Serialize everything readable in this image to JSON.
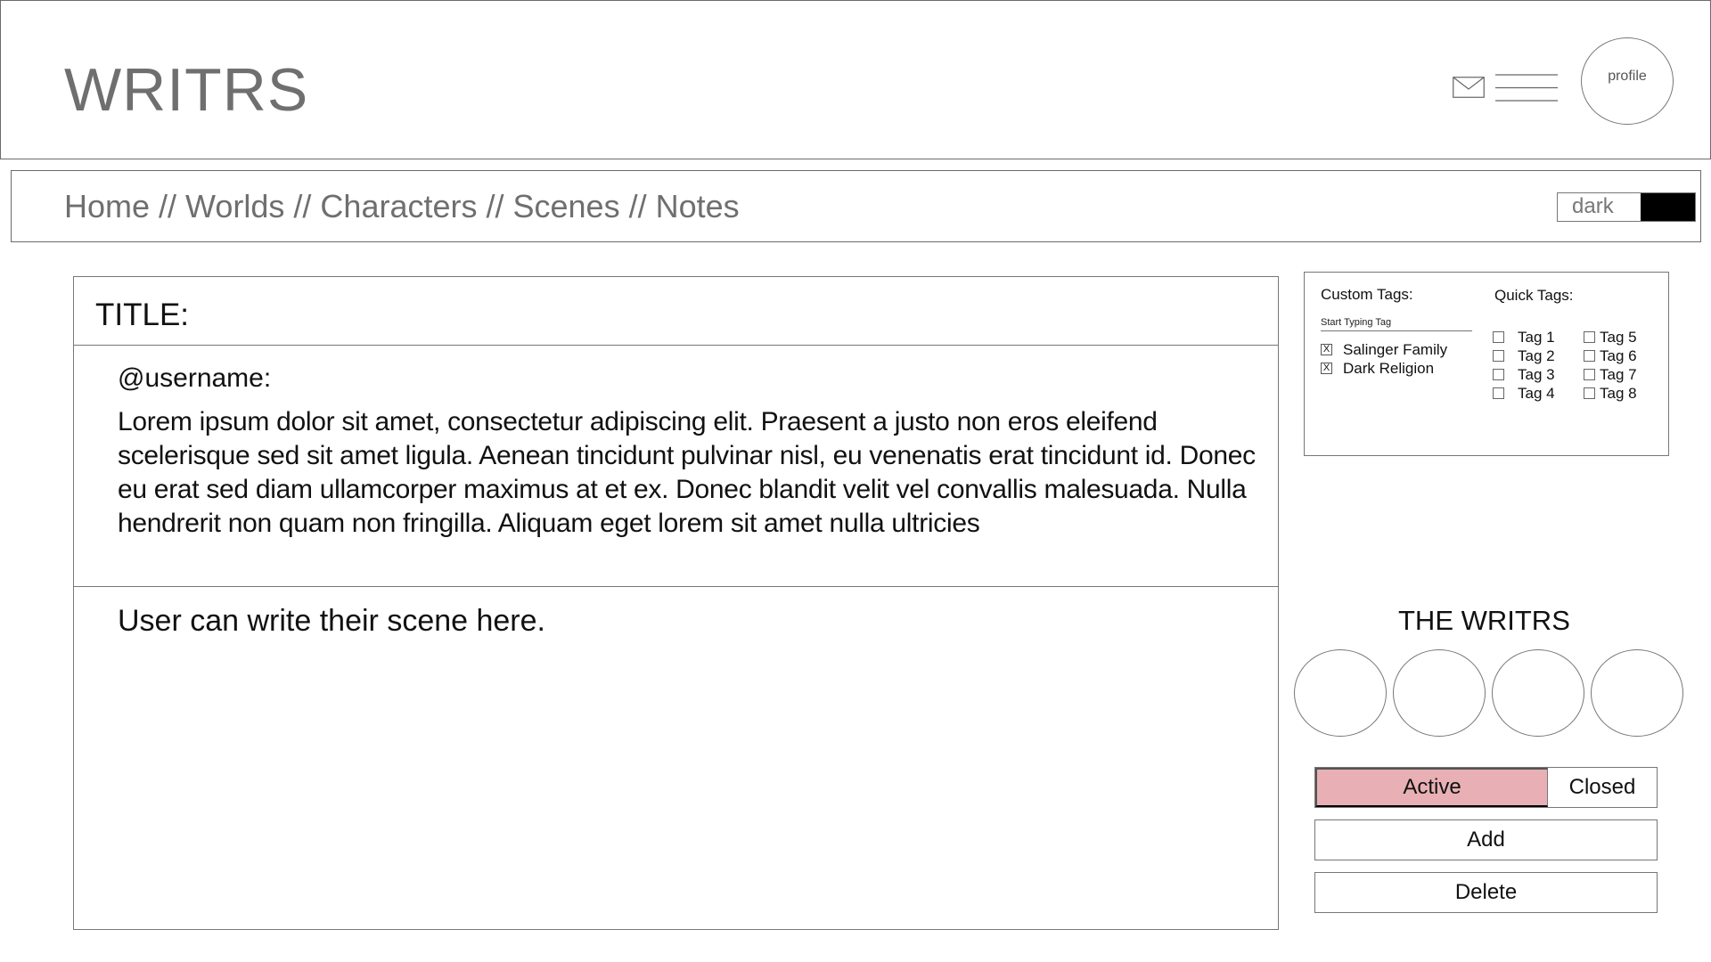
{
  "header": {
    "logo": "WRITRS",
    "icons": {
      "mail": "mail-icon",
      "menu": "hamburger-menu-icon"
    },
    "profile_label": "profile"
  },
  "nav": {
    "breadcrumb": [
      "Home",
      "Worlds",
      "Characters",
      "Scenes",
      "Notes"
    ],
    "separator": " // ",
    "theme_toggle": {
      "label": "dark",
      "swatch_color": "#000000"
    }
  },
  "editor": {
    "title_label": "TITLE:",
    "username": "@username:",
    "prompt_text": "Lorem ipsum dolor sit amet, consectetur adipiscing elit. Praesent a justo non eros eleifend scelerisque sed sit amet ligula. Aenean tincidunt pulvinar nisl, eu venenatis erat tincidunt id. Donec eu erat sed diam ullamcorper maximus at et ex. Donec blandit velit vel convallis malesuada. Nulla hendrerit non quam non fringilla. Aliquam eget lorem sit amet nulla ultricies",
    "scene_placeholder": "User can write their scene here."
  },
  "tags": {
    "custom_title": "Custom Tags:",
    "input_placeholder": "Start Typing Tag",
    "custom_items": [
      {
        "mark": "X",
        "label": "Salinger Family"
      },
      {
        "mark": "X",
        "label": "Dark Religion"
      }
    ],
    "quick_title": "Quick Tags:",
    "quick_col1": [
      "Tag 1",
      "Tag 2",
      "Tag 3",
      "Tag 4"
    ],
    "quick_col2": [
      "Tag 5",
      "Tag 6",
      "Tag 7",
      "Tag 8"
    ]
  },
  "writers": {
    "title": "THE WRITRS"
  },
  "status": {
    "active_label": "Active",
    "closed_label": "Closed",
    "active_color": "#e8b0b4"
  },
  "actions": {
    "add_label": "Add",
    "delete_label": "Delete"
  }
}
